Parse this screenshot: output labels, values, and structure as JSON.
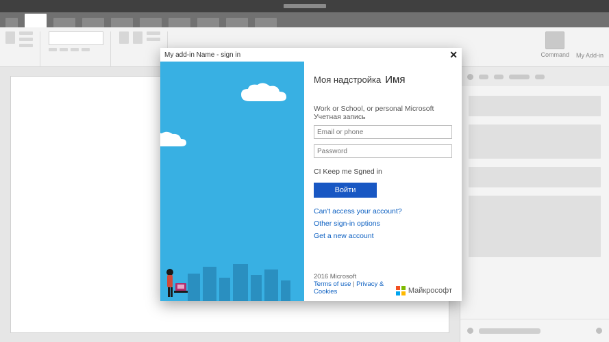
{
  "ribbon": {
    "command_label": "Command",
    "addin_label": "My Add-in"
  },
  "dialog": {
    "title": "My add-in Name - sign in",
    "brand_prefix": "Моя надстройка",
    "brand_name": "Имя",
    "account_type_label": "Work or School, or personal Microsoft Учетная запись",
    "email_placeholder": "Email or phone",
    "password_placeholder": "Password",
    "keep_signed_in": "CI Keep me Sgned in",
    "signin_button": "Войти",
    "links": {
      "cant_access": "Can't access your account?",
      "other_options": "Other sign-in options",
      "new_account": "Get a new account"
    },
    "footer": {
      "copyright": "2016 Microsoft",
      "terms": "Terms of use",
      "separator": " | ",
      "privacy": "Privacy & Cookies"
    },
    "ms_brand": "Майкрософт"
  }
}
